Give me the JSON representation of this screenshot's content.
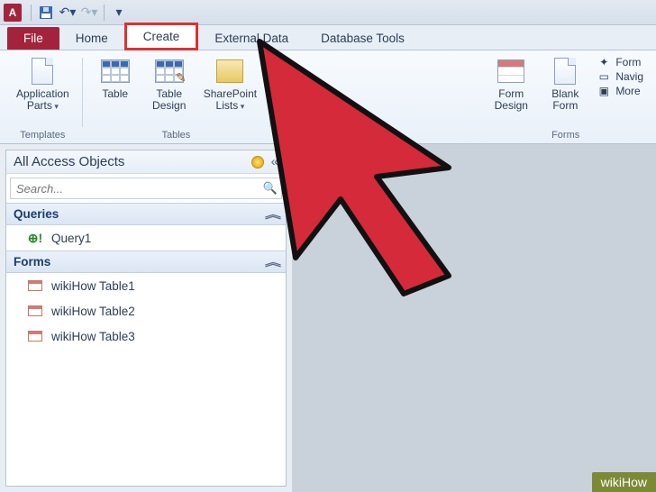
{
  "qat": {
    "app_letter": "A"
  },
  "tabs": {
    "file": "File",
    "home": "Home",
    "create": "Create",
    "external_data": "External Data",
    "database_tools": "Database Tools"
  },
  "ribbon": {
    "templates": {
      "label": "Templates",
      "application_parts": "Application\nParts"
    },
    "tables": {
      "label": "Tables",
      "table": "Table",
      "table_design": "Table\nDesign",
      "sharepoint_lists": "SharePoint\nLists"
    },
    "forms": {
      "label": "Forms",
      "form_design": "Form\nDesign",
      "blank_form": "Blank\nForm",
      "form": "Form",
      "navigation": "Navig",
      "more_forms": "More"
    }
  },
  "nav": {
    "title": "All Access Objects",
    "collapse": "«",
    "search_placeholder": "Search...",
    "sections": {
      "queries": "Queries",
      "forms": "Forms"
    },
    "queries": [
      "Query1"
    ],
    "forms": [
      "wikiHow Table1",
      "wikiHow Table2",
      "wikiHow Table3"
    ]
  },
  "watermark": "wikiHow"
}
